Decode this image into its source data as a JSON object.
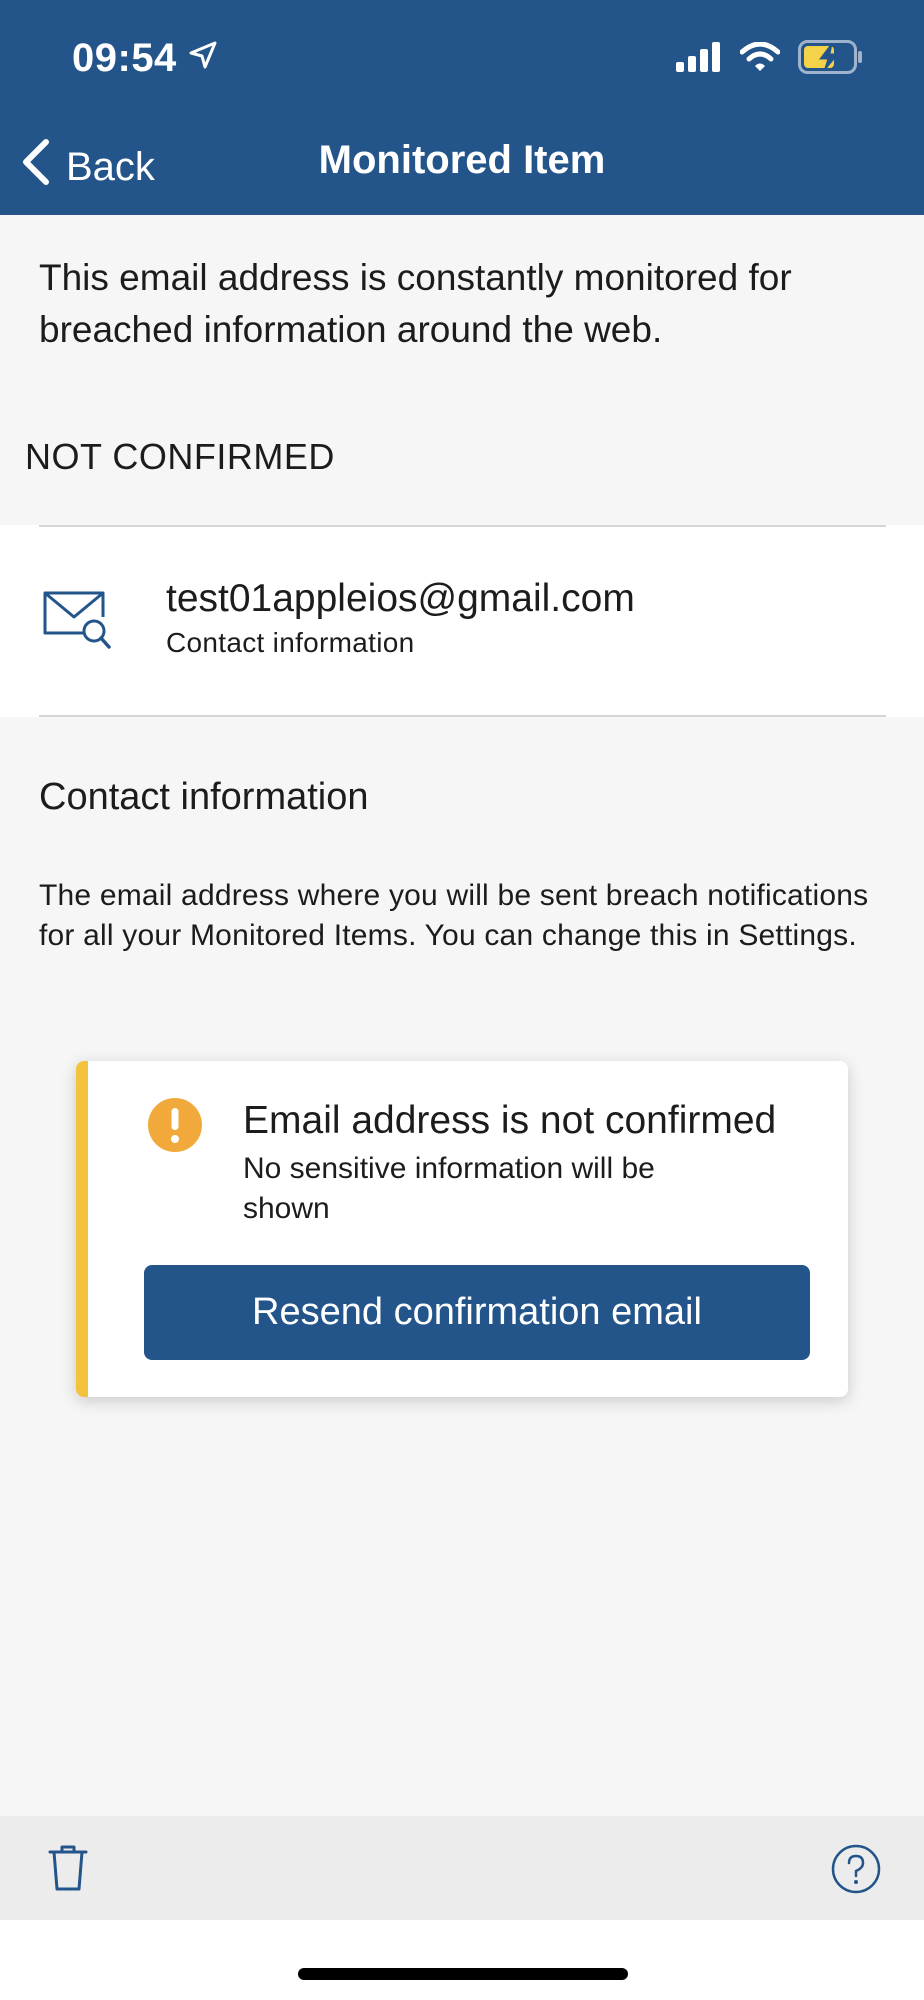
{
  "status_bar": {
    "time": "09:54",
    "icons": [
      "location-arrow-icon",
      "cellular-signal-icon",
      "wifi-icon",
      "battery-charging-icon"
    ]
  },
  "nav": {
    "back_label": "Back",
    "title": "Monitored Item"
  },
  "intro_text": "This email address is constantly monitored for breached information around the web.",
  "section_label": "NOT CONFIRMED",
  "monitored_item": {
    "icon": "mail-search-icon",
    "email": "test01appleios@gmail.com",
    "subtitle": "Contact information"
  },
  "contact_info": {
    "title": "Contact information",
    "description": "The email address where you will be sent breach notifications for all your Monitored Items. You can change this in Settings."
  },
  "alert": {
    "icon": "warning-circle-icon",
    "title": "Email address is not confirmed",
    "text": "No sensitive information will be shown",
    "button_label": "Resend confirmation email"
  },
  "toolbar": {
    "left_icon": "trash-icon",
    "right_icon": "help-icon"
  },
  "colors": {
    "brand": "#23548a",
    "warning": "#f4c33d",
    "warning_icon": "#f2a93b",
    "background": "#f6f6f6"
  }
}
